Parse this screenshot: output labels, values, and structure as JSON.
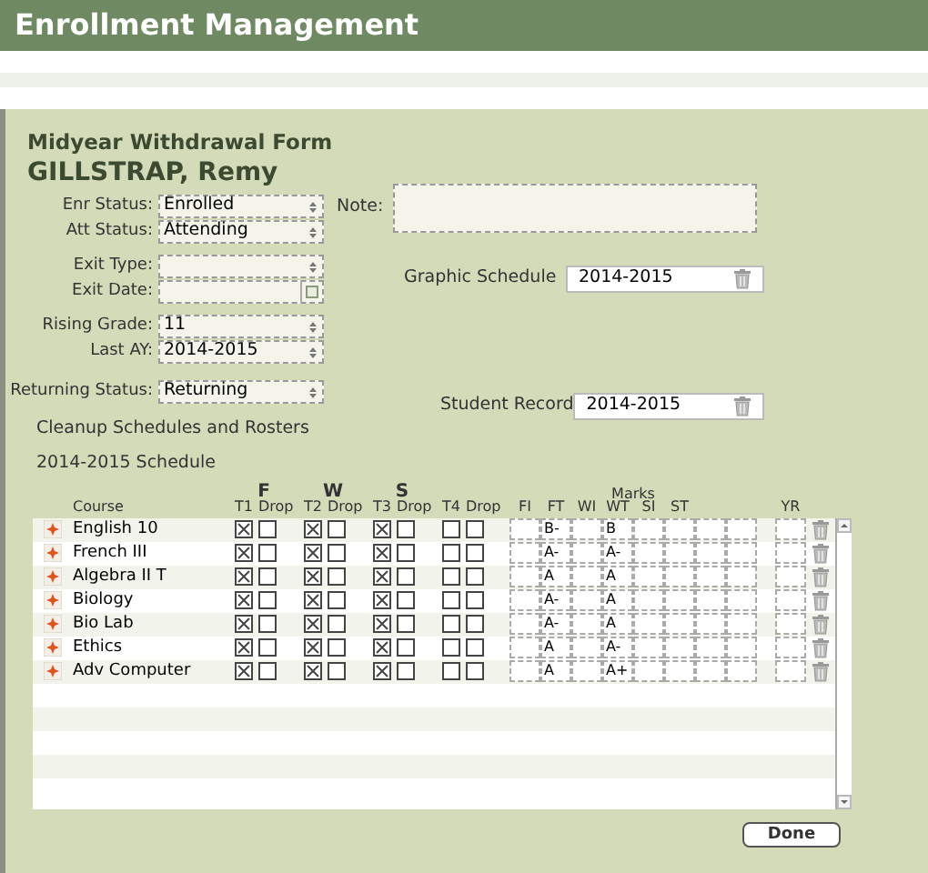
{
  "window": {
    "title": "Enrollment Management"
  },
  "form": {
    "title": "Midyear Withdrawal Form",
    "student": "GILLSTRAP, Remy",
    "fields": [
      {
        "label": "Enr Status:",
        "value": "Enrolled",
        "kind": "select"
      },
      {
        "label": "Att Status:",
        "value": "Attending",
        "kind": "select"
      },
      {
        "label": "Exit Type:",
        "kind": "select"
      },
      {
        "label": "Exit Date:",
        "kind": "date"
      },
      {
        "label": "Rising Grade:",
        "value": "11",
        "kind": "select"
      },
      {
        "label": "Last AY:",
        "value": "2014-2015",
        "kind": "select"
      },
      {
        "label": "Returning Status:",
        "value": "Returning",
        "kind": "select"
      }
    ],
    "note": {
      "label": "Note:"
    },
    "graphic_schedule": {
      "label": "Graphic Schedule",
      "value": "2014-2015"
    },
    "student_record": {
      "label": "Student Record",
      "value": "2014-2015"
    },
    "cleanup_label": "Cleanup Schedules and Rosters"
  },
  "schedule": {
    "title": "2014-2015 Schedule",
    "term_groups": [
      "F",
      "W",
      "S"
    ],
    "marks_label": "Marks",
    "course_label": "Course",
    "term_labels": [
      "T1",
      "T2",
      "T3",
      "T4"
    ],
    "drop_labels": [
      "Drop",
      "Drop",
      "Drop",
      "Drop"
    ],
    "mark_columns": [
      "FI",
      "FT",
      "WI",
      "WT",
      "SI",
      "ST"
    ],
    "yr_label": "YR",
    "rows": [
      {
        "course": "English 10",
        "terms": [
          true,
          true,
          true,
          false
        ],
        "drops": [
          false,
          false,
          false,
          false
        ],
        "ft": "B-",
        "wt": "B"
      },
      {
        "course": "French III",
        "terms": [
          true,
          true,
          true,
          false
        ],
        "drops": [
          false,
          false,
          false,
          false
        ],
        "ft": "A-",
        "wt": "A-"
      },
      {
        "course": "Algebra II T",
        "terms": [
          true,
          true,
          true,
          false
        ],
        "drops": [
          false,
          false,
          false,
          false
        ],
        "ft": "A",
        "wt": "A"
      },
      {
        "course": "Biology",
        "terms": [
          true,
          true,
          true,
          false
        ],
        "drops": [
          false,
          false,
          false,
          false
        ],
        "ft": "A-",
        "wt": "A"
      },
      {
        "course": "Bio Lab",
        "terms": [
          true,
          true,
          true,
          false
        ],
        "drops": [
          false,
          false,
          false,
          false
        ],
        "ft": "A-",
        "wt": "A"
      },
      {
        "course": "Ethics",
        "terms": [
          true,
          true,
          true,
          false
        ],
        "drops": [
          false,
          false,
          false,
          false
        ],
        "ft": "A",
        "wt": "A-"
      },
      {
        "course": "Adv Computer",
        "terms": [
          true,
          true,
          true,
          false
        ],
        "drops": [
          false,
          false,
          false,
          false
        ],
        "ft": "A",
        "wt": "A+"
      }
    ]
  },
  "buttons": [
    "Done"
  ]
}
